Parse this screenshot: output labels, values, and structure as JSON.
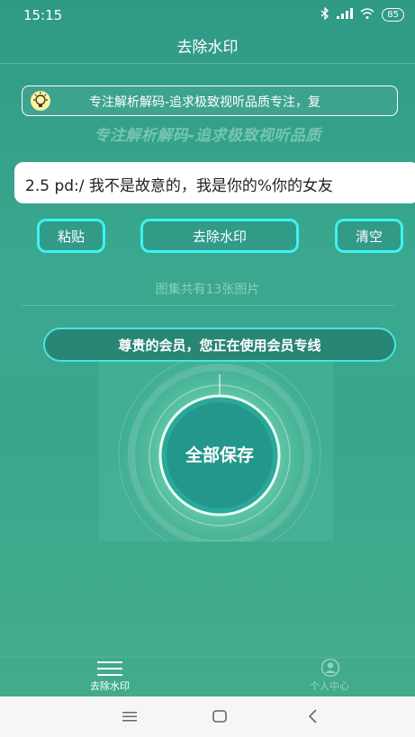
{
  "status_bar": {
    "time": "15:15",
    "battery": "85"
  },
  "header": {
    "title": "去除水印"
  },
  "notice": {
    "text": "专注解析解码-追求极致视听品质专注，复"
  },
  "slogan": "专注解析解码-追求极致视听品质",
  "link_input": {
    "value": "2.5 pd:/ 我不是故意的，我是你的%你的女友"
  },
  "buttons": {
    "paste": "粘贴",
    "remove_watermark": "去除水印",
    "clear": "清空"
  },
  "album_count": "图集共有13张图片",
  "member_banner": "尊贵的会员，您正在使用会员专线",
  "save_all": "全部保存",
  "bottom_nav": {
    "tab_remove": "去除水印",
    "tab_profile": "个人中心"
  },
  "colors": {
    "accent_border": "#3cf3f0",
    "input_bg": "#ffffff"
  }
}
